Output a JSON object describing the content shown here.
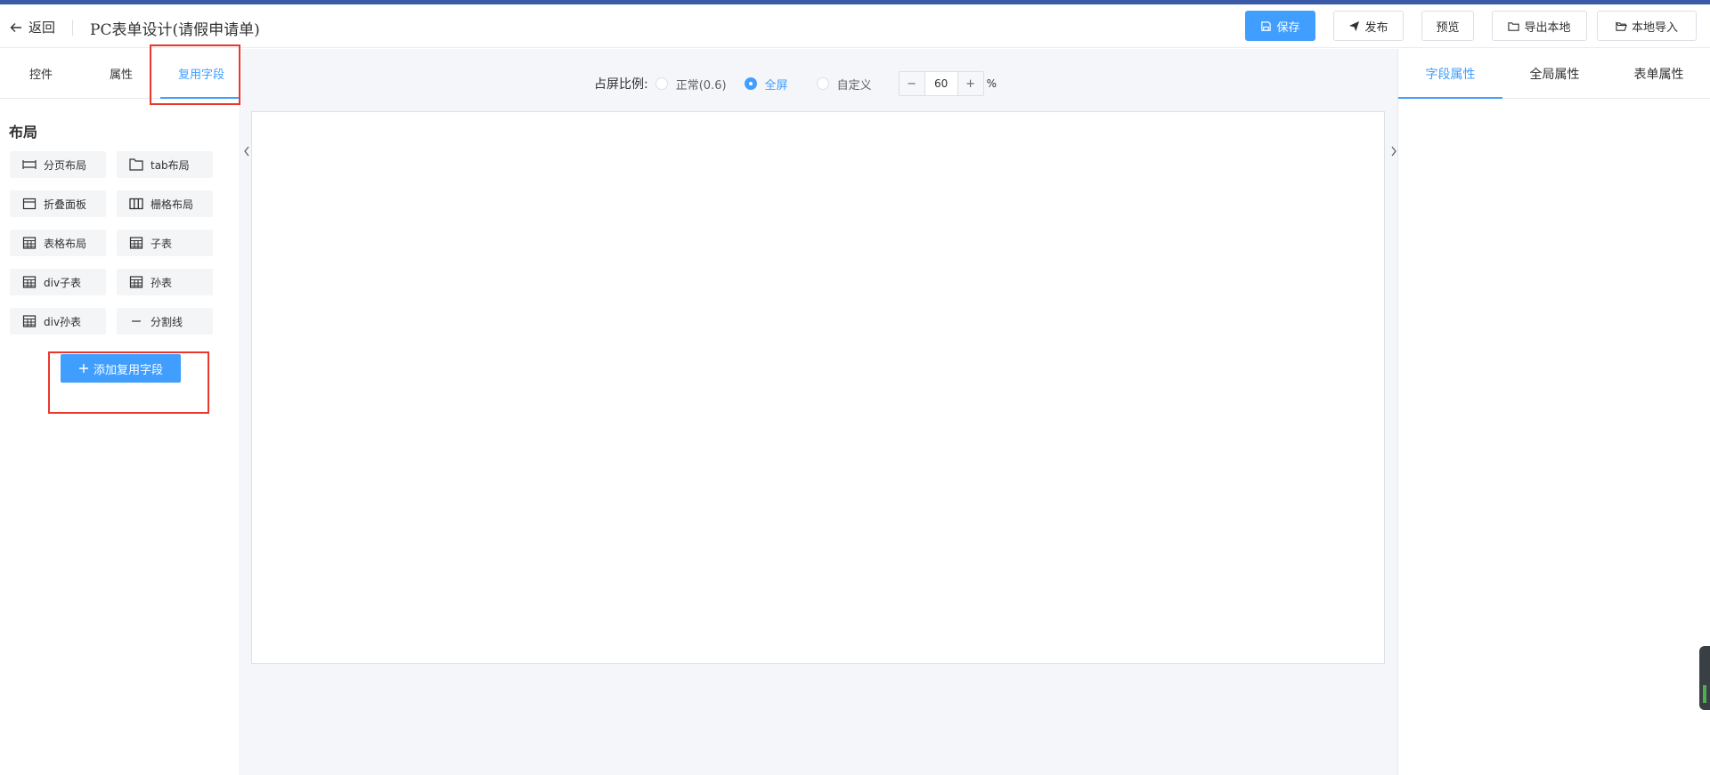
{
  "header": {
    "back_label": "返回",
    "title": "PC表单设计(请假申请单)",
    "buttons": {
      "save": "保存",
      "publish": "发布",
      "preview": "预览",
      "export": "导出本地",
      "import": "本地导入"
    }
  },
  "left_panel": {
    "tabs": [
      "控件",
      "属性",
      "复用字段"
    ],
    "active_tab": "复用字段",
    "section_title": "布局",
    "components": [
      {
        "label": "分页布局",
        "icon": "paging-layout-icon"
      },
      {
        "label": "tab布局",
        "icon": "folder-tab-icon"
      },
      {
        "label": "折叠面板",
        "icon": "collapse-panel-icon"
      },
      {
        "label": "栅格布局",
        "icon": "grid-columns-icon"
      },
      {
        "label": "表格布局",
        "icon": "table-icon"
      },
      {
        "label": "子表",
        "icon": "table-icon"
      },
      {
        "label": "div子表",
        "icon": "table-icon"
      },
      {
        "label": "孙表",
        "icon": "table-icon"
      },
      {
        "label": "div孙表",
        "icon": "table-icon"
      },
      {
        "label": "分割线",
        "icon": "divider-icon"
      }
    ],
    "add_reuse_button": "添加复用字段"
  },
  "center": {
    "ratio_label": "占屏比例:",
    "ratio_options": [
      {
        "label": "正常(0.6)",
        "selected": false
      },
      {
        "label": "全屏",
        "selected": true
      },
      {
        "label": "自定义",
        "selected": false
      }
    ],
    "zoom": {
      "minus": "−",
      "value": "60",
      "plus": "+",
      "unit": "%"
    }
  },
  "right_panel": {
    "tabs": [
      "字段属性",
      "全局属性",
      "表单属性"
    ],
    "active_tab": "字段属性"
  },
  "colors": {
    "accent": "#409eff",
    "highlight_box": "#e8382c",
    "top_stripe": "#3b5ba8"
  }
}
